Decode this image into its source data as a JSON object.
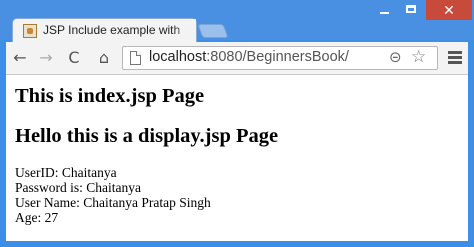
{
  "browser": {
    "tab_title": "JSP Include example with",
    "url_host": "localhost",
    "url_rest": ":8080/BeginnersBook/",
    "icons": [
      "page-favicon-icon",
      "back-arrow-icon",
      "forward-arrow-icon",
      "reload-icon",
      "home-icon",
      "page-icon",
      "zoom-icon",
      "star-icon",
      "menu-icon",
      "minimize-icon",
      "maximize-icon",
      "close-icon"
    ],
    "nav": {
      "back": "←",
      "forward": "→",
      "reload": "C",
      "home": "⌂"
    },
    "zoom_glyph": "⊝",
    "star_glyph": "☆",
    "close_glyph": "✕"
  },
  "page": {
    "heading1": "This is index.jsp Page",
    "heading2": "Hello this is a display.jsp Page",
    "lines": [
      "UserID: Chaitanya",
      "Password is: Chaitanya",
      "User Name: Chaitanya Pratap Singh",
      "Age: 27"
    ]
  },
  "colors": {
    "window_frame": "#4a90e2",
    "close_button": "#c74a3a"
  }
}
